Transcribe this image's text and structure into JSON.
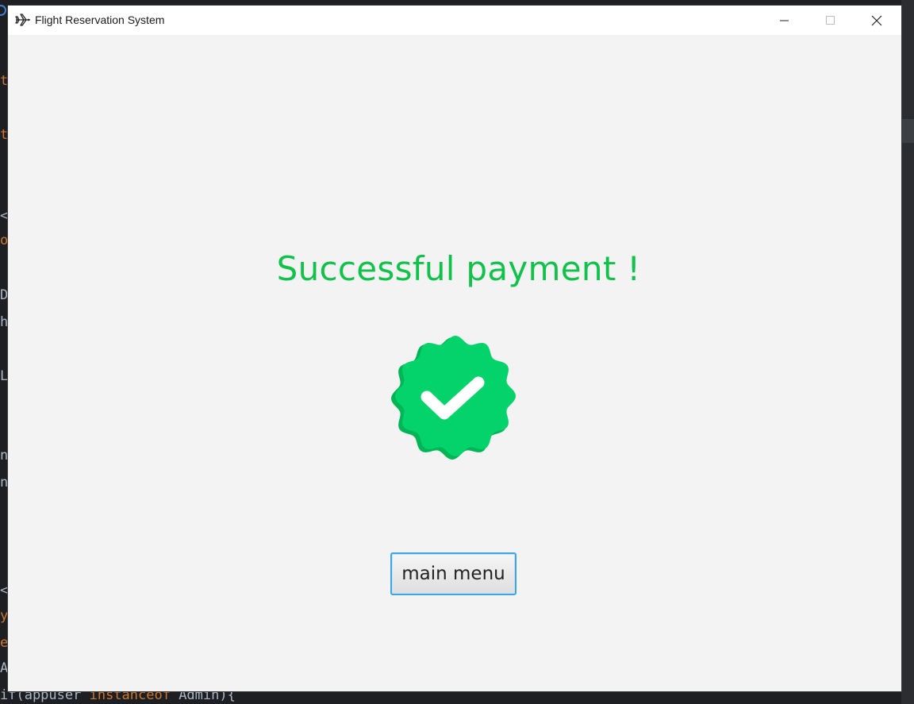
{
  "window": {
    "title": "Flight Reservation System",
    "icon": "airplane-icon",
    "controls": [
      "minimize-icon",
      "maximize-icon",
      "close-icon"
    ]
  },
  "main": {
    "heading": "Successful payment !",
    "badge_icon": "verified-check-badge-icon",
    "button_label": "main menu"
  },
  "background_ide": {
    "bottom_line_parts": [
      "if(appuser ",
      "instanceof",
      " Admin){"
    ]
  },
  "colors": {
    "heading": "#11c24a",
    "badge": "#03d36a",
    "badge_shadow": "#00b557",
    "button_border": "#3fa4e6",
    "window_bg": "#f3f3f3"
  }
}
